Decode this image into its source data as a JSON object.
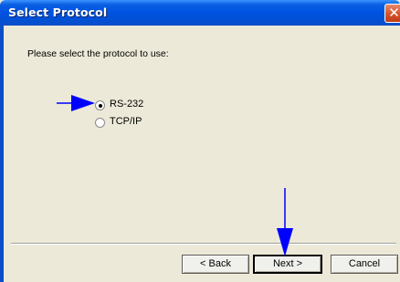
{
  "window": {
    "title": "Select Protocol",
    "close_symbol": "✕",
    "accent_color": "#0054e3"
  },
  "content": {
    "prompt": "Please select the protocol to use:",
    "options": [
      {
        "label": "RS-232",
        "selected": true
      },
      {
        "label": "TCP/IP",
        "selected": false
      }
    ]
  },
  "buttons": {
    "back": "< Back",
    "next": "Next >",
    "cancel": "Cancel"
  },
  "annotations": {
    "arrow_color": "#0000ff",
    "arrows": [
      "arrow-to-rs232",
      "arrow-to-next"
    ]
  }
}
